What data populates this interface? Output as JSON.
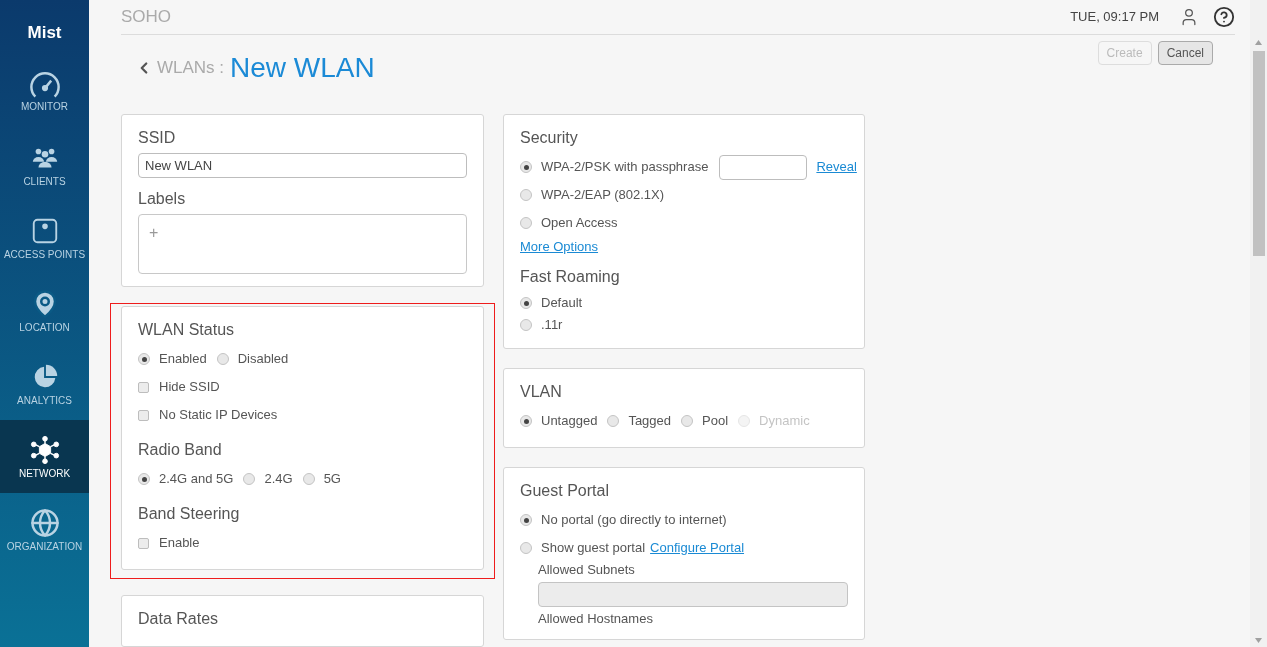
{
  "header": {
    "site": "SOHO",
    "time": "TUE, 09:17 PM"
  },
  "sidebar": {
    "logo": "Mist",
    "items": [
      {
        "label": "MONITOR",
        "selected": false
      },
      {
        "label": "CLIENTS",
        "selected": false
      },
      {
        "label": "ACCESS POINTS",
        "selected": false
      },
      {
        "label": "LOCATION",
        "selected": false
      },
      {
        "label": "ANALYTICS",
        "selected": false
      },
      {
        "label": "NETWORK",
        "selected": true
      },
      {
        "label": "ORGANIZATION",
        "selected": false
      }
    ]
  },
  "page": {
    "breadcrumb": "WLANs :",
    "title": "New WLAN"
  },
  "actions": [
    {
      "label": "Create",
      "disabled": true
    },
    {
      "label": "Cancel",
      "disabled": false
    }
  ],
  "left_cards": [
    {
      "highlighted": false,
      "sections": [
        {
          "title": "SSID",
          "items": [
            {
              "kind": "text_field",
              "value": "New WLAN"
            }
          ]
        },
        {
          "title": "Labels",
          "items": [
            {
              "kind": "tags_field",
              "add": "+"
            }
          ]
        }
      ]
    },
    {
      "highlighted": true,
      "sections": [
        {
          "title": "WLAN Status",
          "items": [
            {
              "kind": "radio_row",
              "options": [
                {
                  "label": "Enabled",
                  "selected": true,
                  "disabled": false
                },
                {
                  "label": "Disabled",
                  "selected": false,
                  "disabled": false
                }
              ]
            },
            {
              "kind": "checkbox",
              "label": "Hide SSID",
              "checked": false
            },
            {
              "kind": "checkbox",
              "label": "No Static IP Devices",
              "checked": false
            }
          ]
        },
        {
          "title": "Radio Band",
          "items": [
            {
              "kind": "radio_row",
              "options": [
                {
                  "label": "2.4G and 5G",
                  "selected": true,
                  "disabled": false
                },
                {
                  "label": "2.4G",
                  "selected": false,
                  "disabled": false
                },
                {
                  "label": "5G",
                  "selected": false,
                  "disabled": false
                }
              ]
            }
          ]
        },
        {
          "title": "Band Steering",
          "items": [
            {
              "kind": "checkbox",
              "label": "Enable",
              "checked": false
            }
          ]
        }
      ]
    },
    {
      "highlighted": false,
      "sections": [
        {
          "title": "Data Rates"
        }
      ]
    }
  ],
  "right_cards": [
    {
      "highlighted": false,
      "sections": [
        {
          "title": "Security",
          "items": [
            {
              "kind": "radio_field",
              "label": "WPA-2/PSK with passphrase",
              "selected": true,
              "link": "Reveal"
            },
            {
              "kind": "radio",
              "label": "WPA-2/EAP (802.1X)",
              "selected": false
            },
            {
              "kind": "radio",
              "label": "Open Access",
              "selected": false
            },
            {
              "kind": "link",
              "label": "More Options"
            }
          ]
        },
        {
          "title": "Fast Roaming",
          "items": [
            {
              "kind": "radio_compact",
              "label": "Default",
              "selected": true
            },
            {
              "kind": "radio_compact",
              "label": ".11r",
              "selected": false
            }
          ]
        }
      ]
    },
    {
      "highlighted": false,
      "sections": [
        {
          "title": "VLAN",
          "items": [
            {
              "kind": "radio_row",
              "options": [
                {
                  "label": "Untagged",
                  "selected": true,
                  "disabled": false
                },
                {
                  "label": "Tagged",
                  "selected": false,
                  "disabled": false
                },
                {
                  "label": "Pool",
                  "selected": false,
                  "disabled": false
                },
                {
                  "label": "Dynamic",
                  "selected": false,
                  "disabled": true
                }
              ]
            }
          ]
        }
      ]
    },
    {
      "highlighted": false,
      "sections": [
        {
          "title": "Guest Portal",
          "items": [
            {
              "kind": "radio",
              "label": "No portal (go directly to internet)",
              "selected": true
            },
            {
              "kind": "radio",
              "label": "Show guest portal",
              "selected": false,
              "inline_link": "Configure Portal"
            },
            {
              "kind": "sub_label",
              "label": "Allowed Subnets"
            },
            {
              "kind": "disabled_field"
            },
            {
              "kind": "sub_label",
              "label": "Allowed Hostnames"
            }
          ]
        }
      ]
    }
  ]
}
